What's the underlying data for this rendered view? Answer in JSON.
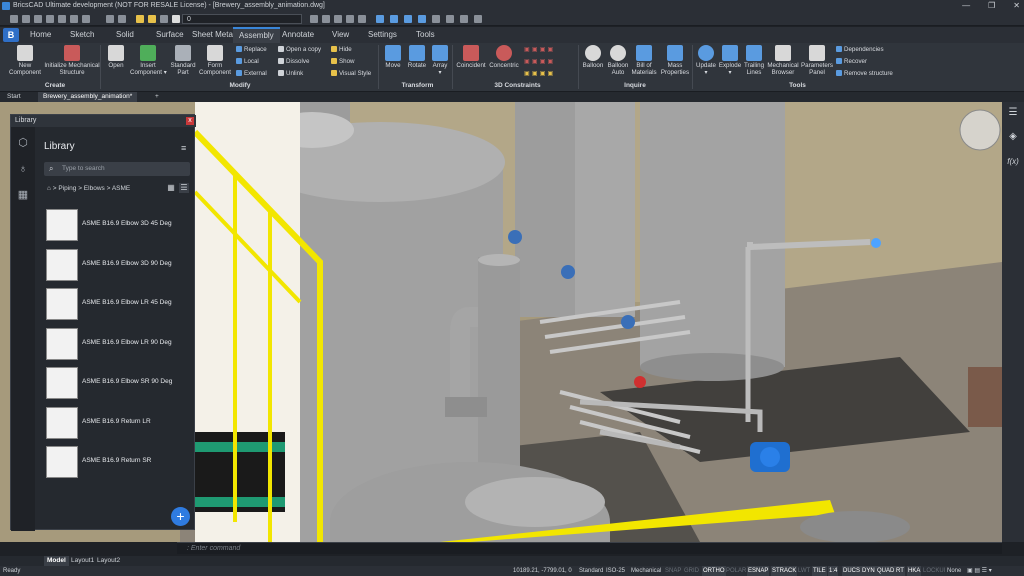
{
  "window": {
    "title": "BricsCAD Ultimate development (NOT FOR RESALE License) - [Brewery_assembly_animation.dwg]",
    "controls": [
      "—",
      "❐",
      "✕"
    ]
  },
  "quick_access": {
    "layer_value": "0"
  },
  "app_button": "B",
  "menu_tabs": [
    "Home",
    "Sketch",
    "Solid",
    "Surface",
    "Sheet Metal",
    "Assembly",
    "Annotate",
    "View",
    "Settings",
    "Tools"
  ],
  "active_tab": "Assembly",
  "ribbon": {
    "create": {
      "panel": "Create",
      "new_component": "New\nComponent",
      "initialize": "Initialize Mechanical\nStructure"
    },
    "modify": {
      "panel": "Modify",
      "open": "Open",
      "insert": "Insert\nComponent ▾",
      "standard_part": "Standard\nPart",
      "form": "Form\nComponent",
      "replace": "Replace",
      "local": "Local",
      "external": "External",
      "open_copy": "Open a copy",
      "dissolve": "Dissolve",
      "unlink": "Unlink",
      "hide": "Hide",
      "show": "Show",
      "visual_style": "Visual Style"
    },
    "transform": {
      "panel": "Transform",
      "move": "Move",
      "rotate": "Rotate",
      "array": "Array\n▾"
    },
    "constraints": {
      "panel": "3D Constraints",
      "coincident": "Coincident",
      "concentric": "Concentric"
    },
    "inquire": {
      "panel": "Inquire",
      "balloon": "Balloon",
      "balloon_auto": "Balloon\nAuto",
      "bom": "Bill of\nMaterials",
      "mass": "Mass\nProperties"
    },
    "tools": {
      "panel": "Tools",
      "update": "Update\n▾",
      "explode": "Explode\n▾",
      "trailing": "Trailing\nLines",
      "browser": "Mechanical\nBrowser",
      "params": "Parameters\nPanel",
      "dependencies": "Dependencies",
      "recover": "Recover",
      "remove": "Remove structure"
    }
  },
  "doc_tabs": [
    "Start",
    "Brewery_assembly_animation*",
    "+"
  ],
  "library": {
    "window_title": "Library",
    "close": "x",
    "heading": "Library",
    "menu": "≡",
    "search_placeholder": "Type to search",
    "breadcrumb": "⌂  >  Piping  >  Elbows  >  ASME",
    "items": [
      "ASME B16.9 Elbow 3D 45 Deg",
      "ASME B16.9 Elbow 3D 90 Deg",
      "ASME B16.9 Elbow LR 45 Deg",
      "ASME B16.9 Elbow LR 90 Deg",
      "ASME B16.9 Elbow SR 90 Deg",
      "ASME B16.9 Return LR",
      "ASME B16.9 Return SR"
    ],
    "add": "+"
  },
  "right_bar": {
    "fx": "f(x)"
  },
  "command": {
    "placeholder": ": Enter command"
  },
  "layout_tabs": [
    "Model",
    "Layout1",
    "Layout2"
  ],
  "status": {
    "ready": "Ready",
    "coords": "10189.21, -7799.01, 0",
    "standard": "Standard",
    "iso": "ISO-25",
    "mechanical": "Mechanical",
    "toggles": [
      "SNAP",
      "GRID",
      "ORTHO",
      "POLAR",
      "ESNAP",
      "STRACK",
      "LWT",
      "TILE",
      "1:4",
      "DUCS",
      "DYN",
      "QUAD",
      "RT",
      "HKA",
      "LOCKUI",
      "None"
    ]
  },
  "colors": {
    "accent": "#3a86d8",
    "rail_yellow": "#f2e600",
    "platform_green": "#1f9a72",
    "motor_blue": "#1f6fd0",
    "steel": "#9a9a9a",
    "floor": "#8c8478"
  }
}
